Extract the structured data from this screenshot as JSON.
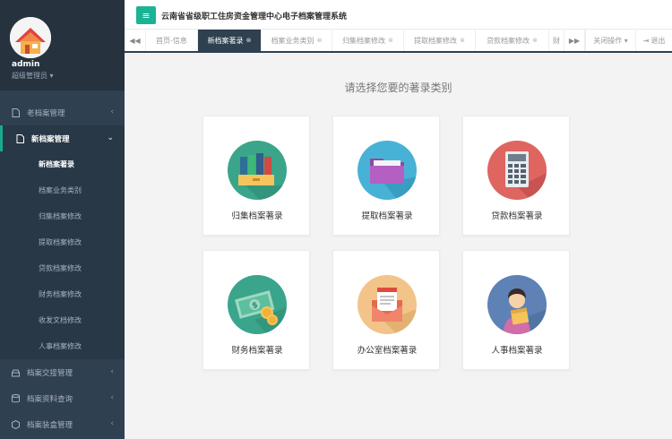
{
  "user": {
    "name": "admin",
    "role": "超级管理员 ▾"
  },
  "app": {
    "title": "云南省省级职工住房资金管理中心电子档案管理系统"
  },
  "sidebar": {
    "items": [
      {
        "label": "老档案管理",
        "arrow": "‹"
      },
      {
        "label": "新档案管理",
        "arrow": "⌄"
      },
      {
        "label": "档案交接管理",
        "arrow": "‹"
      },
      {
        "label": "档案资料查询",
        "arrow": "‹"
      },
      {
        "label": "档案装盒管理",
        "arrow": "‹"
      }
    ],
    "subitems": [
      "新档案著录",
      "档案业务类别",
      "归集档案修改",
      "提取档案修改",
      "贷款档案修改",
      "财务档案修改",
      "收发文档修改",
      "人事档案修改"
    ]
  },
  "tabs": [
    {
      "label": "首页-信息",
      "close": ""
    },
    {
      "label": "新档案著录",
      "close": "⊗"
    },
    {
      "label": "档案业务类别",
      "close": "⊗"
    },
    {
      "label": "归集档案修改",
      "close": "⊗"
    },
    {
      "label": "提取档案修改",
      "close": "⊗"
    },
    {
      "label": "贷款档案修改",
      "close": "⊗"
    },
    {
      "label": "财",
      "close": ""
    }
  ],
  "toolbar": {
    "close_ops": "关闭操作 ▾",
    "logout": "退出",
    "menu_icon": "≡",
    "prev": "◀◀",
    "next": "▶▶"
  },
  "main": {
    "heading": "请选择您要的著录类别",
    "cards": [
      {
        "label": "归集档案著录",
        "icon": "books-icon",
        "color": "#3aa58b"
      },
      {
        "label": "提取档案著录",
        "icon": "folder-icon",
        "color": "#48b2d6"
      },
      {
        "label": "贷款档案著录",
        "icon": "calculator-icon",
        "color": "#df6560"
      },
      {
        "label": "财务档案著录",
        "icon": "money-icon",
        "color": "#3aa58b"
      },
      {
        "label": "办公室档案著录",
        "icon": "mail-icon",
        "color": "#f2c489"
      },
      {
        "label": "人事档案著录",
        "icon": "person-icon",
        "color": "#5e82b5"
      }
    ]
  }
}
